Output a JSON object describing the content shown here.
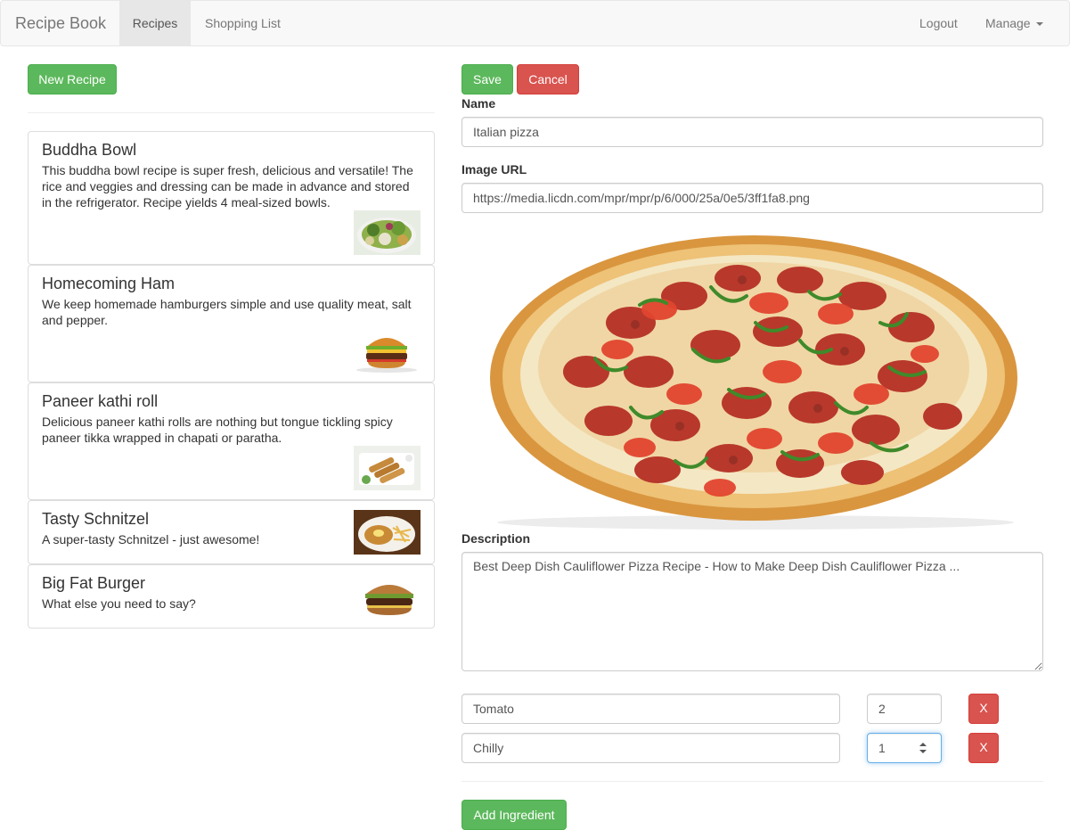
{
  "navbar": {
    "brand": "Recipe Book",
    "links": [
      {
        "label": "Recipes",
        "active": true
      },
      {
        "label": "Shopping List",
        "active": false
      }
    ],
    "right": [
      {
        "label": "Logout"
      },
      {
        "label": "Manage",
        "icon": "caret-down-icon"
      }
    ]
  },
  "sidebar": {
    "new_recipe_label": "New Recipe",
    "recipes": [
      {
        "name": "Buddha Bowl",
        "description": "This buddha bowl recipe is super fresh, delicious and versatile! The rice and veggies and dressing can be made in advance and stored in the refrigerator. Recipe yields 4 meal-sized bowls.",
        "thumbnail": "buddha-bowl-thumbnail"
      },
      {
        "name": "Homecoming Ham",
        "description": "We keep homemade hamburgers simple and use quality meat, salt and pepper.",
        "thumbnail": "hamburger-thumbnail"
      },
      {
        "name": "Paneer kathi roll",
        "description": "Delicious paneer kathi rolls are nothing but tongue tickling spicy paneer tikka wrapped in chapati or paratha.",
        "thumbnail": "kathi-roll-thumbnail"
      },
      {
        "name": "Tasty Schnitzel",
        "description": "A super-tasty Schnitzel - just awesome!",
        "thumbnail": "schnitzel-thumbnail"
      },
      {
        "name": "Big Fat Burger",
        "description": "What else you need to say?",
        "thumbnail": "burger-thumbnail"
      }
    ]
  },
  "form": {
    "save_label": "Save",
    "cancel_label": "Cancel",
    "name_label": "Name",
    "name_value": "Italian pizza",
    "image_url_label": "Image URL",
    "image_url_value": "https://media.licdn.com/mpr/mpr/p/6/000/25a/0e5/3ff1fa8.png",
    "image_preview": "pepperoni-pizza-image",
    "description_label": "Description",
    "description_value": "Best Deep Dish Cauliflower Pizza Recipe - How to Make Deep Dish Cauliflower Pizza ...",
    "ingredients": [
      {
        "name": "Tomato",
        "amount": "2",
        "remove_label": "X"
      },
      {
        "name": "Chilly",
        "amount": "1",
        "remove_label": "X"
      }
    ],
    "add_ingredient_label": "Add Ingredient"
  },
  "colors": {
    "success": "#5cb85c",
    "danger": "#d9534f",
    "navbar_bg": "#f8f8f8",
    "focus_border": "#66afe9"
  }
}
